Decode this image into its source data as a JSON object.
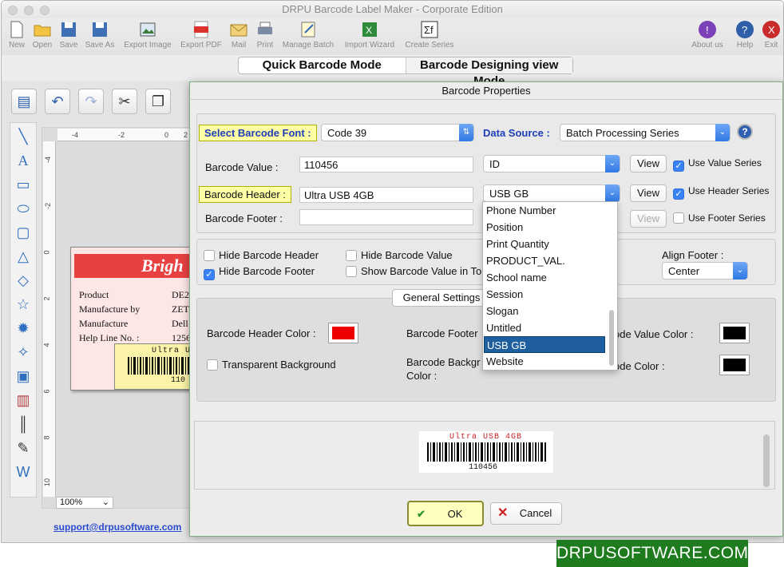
{
  "window": {
    "title": "DRPU Barcode Label Maker - Corporate Edition"
  },
  "toolbar": {
    "items": [
      "New",
      "Open",
      "Save",
      "Save As",
      "Export Image",
      "Export PDF",
      "Mail",
      "Print",
      "Manage Batch",
      "Import Wizard",
      "Create Series"
    ],
    "right_items": [
      "About us",
      "Help",
      "Exit"
    ]
  },
  "modes": {
    "quick": "Quick Barcode Mode",
    "designing": "Barcode Designing view Mode"
  },
  "rulers": {
    "h": [
      "-4",
      "-2",
      "0",
      "2"
    ],
    "v": [
      "-4",
      "-2",
      "0",
      "2",
      "4",
      "6",
      "8",
      "10"
    ]
  },
  "label": {
    "banner": "Brigh",
    "rows": [
      {
        "k": "Product",
        "v": "DE2"
      },
      {
        "k": "Manufacture by",
        "v": "ZET"
      },
      {
        "k": "Manufacture",
        "v": "Dell"
      },
      {
        "k": "Help Line No. :",
        "v": "1256"
      }
    ],
    "bc_header": "Ultra U",
    "bc_value": "110"
  },
  "zoom": "100%",
  "support_link": "support@drpusoftware.com",
  "dialog": {
    "title": "Barcode Properties",
    "font_label": "Select Barcode Font :",
    "font_value": "Code 39",
    "datasource_label": "Data Source :",
    "datasource_value": "Batch Processing Series",
    "help_glyph": "?",
    "value_label": "Barcode Value :",
    "value": "110456",
    "value_series": "ID",
    "view": "View",
    "use_value_series": "Use Value Series",
    "header_label": "Barcode Header :",
    "header": "Ultra USB 4GB",
    "header_series": "USB GB",
    "use_header_series": "Use Header Series",
    "footer_label": "Barcode Footer :",
    "footer": "",
    "use_footer_series": "Use Footer Series",
    "hide_header": "Hide Barcode Header",
    "hide_footer": "Hide Barcode Footer",
    "hide_value": "Hide Barcode Value",
    "show_value_in": "Show Barcode Value in To",
    "align_footer_label": "Align Footer :",
    "align_footer": "Center",
    "general_settings": "General Settings",
    "header_color_label": "Barcode Header Color :",
    "footer_color_label": "Barcode Footer",
    "value_color_label": "ode Value Color :",
    "transparent_bg": "Transparent Background",
    "bg_color_label_1": "Barcode Backgr",
    "bg_color_label_2": "Color :",
    "bar_color_label": "ode Color :",
    "header_color": "#ee0000",
    "value_color": "#000000",
    "bar_color": "#000000",
    "ok": "OK",
    "cancel": "Cancel"
  },
  "dropdown": {
    "items": [
      "Phone Number",
      "Position",
      "Print Quantity",
      "PRODUCT_VAL.",
      "School name",
      "Session",
      "Slogan",
      "Untitled",
      "USB GB",
      "Website"
    ],
    "selected": "USB GB"
  },
  "preview": {
    "header": "Ultra USB 4GB",
    "value": "110456"
  },
  "brand": "DRPUSOFTWARE.COM"
}
